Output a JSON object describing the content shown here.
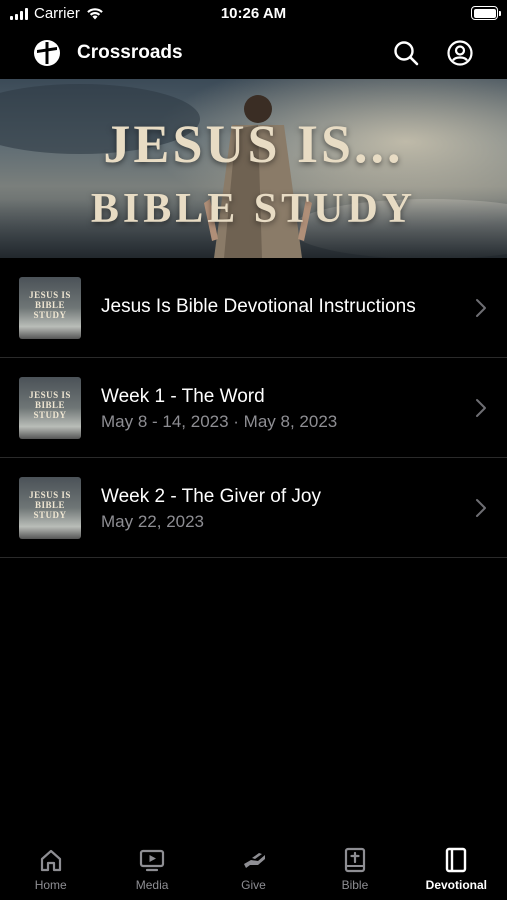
{
  "status_bar": {
    "carrier": "Carrier",
    "time": "10:26 AM"
  },
  "header": {
    "title": "Crossroads"
  },
  "hero": {
    "line1": "JESUS IS...",
    "line2": "BIBLE STUDY"
  },
  "items": [
    {
      "title": "Jesus Is Bible Devotional Instructions",
      "subtitle": "",
      "thumb": [
        "JESUS IS",
        "BIBLE",
        "STUDY"
      ]
    },
    {
      "title": "Week 1 - The Word",
      "subtitle": "May 8 - 14, 2023 · May 8, 2023",
      "thumb": [
        "JESUS IS",
        "BIBLE",
        "STUDY"
      ]
    },
    {
      "title": "Week 2 - The Giver of Joy",
      "subtitle": "May 22, 2023",
      "thumb": [
        "JESUS IS",
        "BIBLE",
        "STUDY"
      ]
    }
  ],
  "tabs": [
    {
      "label": "Home",
      "icon": "home-icon"
    },
    {
      "label": "Media",
      "icon": "media-icon"
    },
    {
      "label": "Give",
      "icon": "give-icon"
    },
    {
      "label": "Bible",
      "icon": "bible-icon"
    },
    {
      "label": "Devotional",
      "icon": "devotional-icon",
      "active": true
    }
  ],
  "colors": {
    "background": "#000000",
    "secondary_text": "#8e8e93",
    "hero_text": "#e8dcc4"
  }
}
